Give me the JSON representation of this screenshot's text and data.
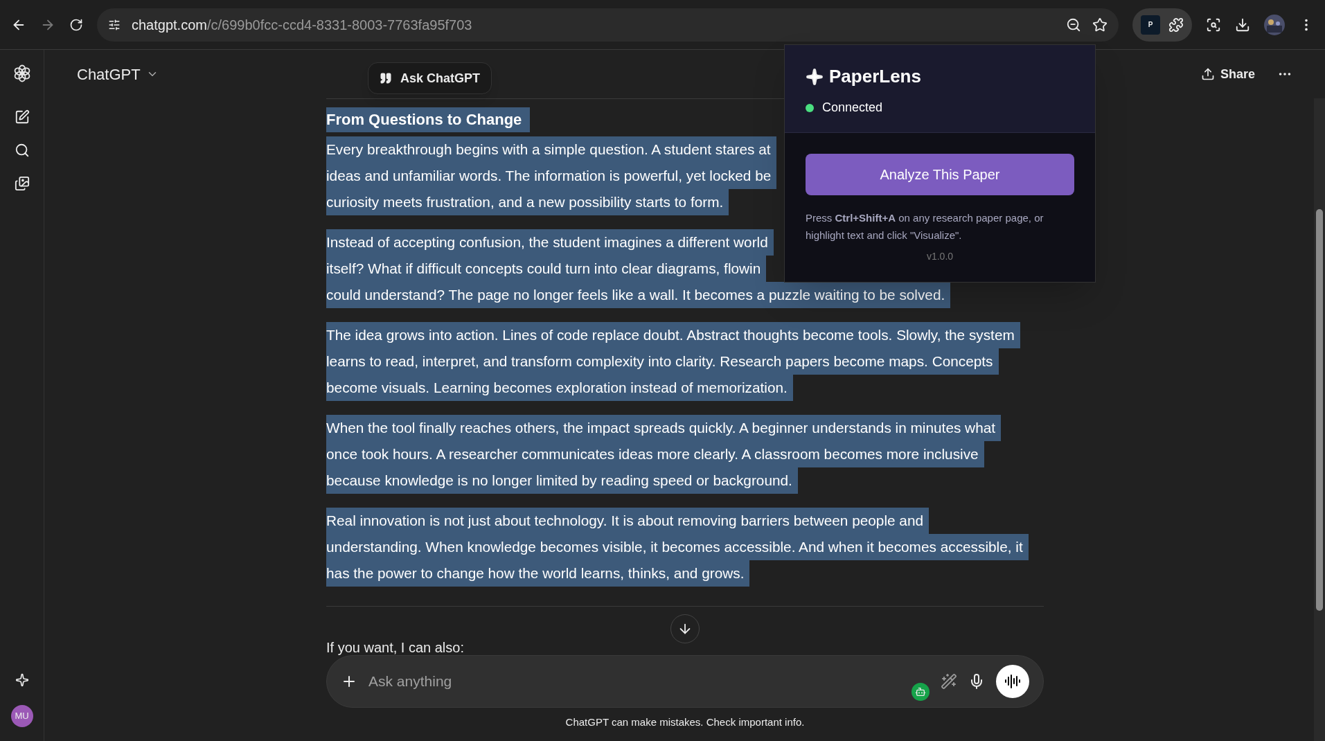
{
  "browser": {
    "url_host": "chatgpt.com",
    "url_path": "/c/699b0fcc-ccd4-8331-8003-7763fa95f703",
    "extension_badge": "P"
  },
  "header": {
    "title": "ChatGPT",
    "share": "Share"
  },
  "sidebar": {
    "avatar": "MU"
  },
  "ask_button": "Ask ChatGPT",
  "article": {
    "heading": "From Questions to Change",
    "paragraphs": [
      [
        "Every breakthrough begins with a simple question. A student stares at",
        "ideas and unfamiliar words. The information is powerful, yet locked be",
        "curiosity meets frustration, and a new possibility starts to form."
      ],
      [
        "Instead of accepting confusion, the student imagines a different world",
        "itself? What if difficult concepts could turn into clear diagrams, flowin",
        "could understand? The page no longer feels like a wall. It becomes a puzzle waiting to be solved."
      ],
      [
        "The idea grows into action. Lines of code replace doubt. Abstract thoughts become tools. Slowly, the system",
        "learns to read, interpret, and transform complexity into clarity. Research papers become maps. Concepts",
        "become visuals. Learning becomes exploration instead of memorization."
      ],
      [
        "When the tool finally reaches others, the impact spreads quickly. A beginner understands in minutes what",
        "once took hours. A researcher communicates ideas more clearly. A classroom becomes more inclusive",
        "because knowledge is no longer limited by reading speed or background."
      ],
      [
        "Real innovation is not just about technology. It is about removing barriers between people and",
        "understanding. When knowledge becomes visible, it becomes accessible. And when it becomes accessible, it",
        "has the power to change how the world learns, thinks, and grows."
      ]
    ]
  },
  "follow_up": "If you want, I can also:",
  "composer": {
    "placeholder": "Ask anything"
  },
  "disclaimer": "ChatGPT can make mistakes. Check important info.",
  "popup": {
    "title": "PaperLens",
    "status": {
      "label": "Connected",
      "connected": true
    },
    "button": "Analyze This Paper",
    "help": "Press **Ctrl+Shift+A** on any research paper page, or highlight text and click \"Visualize\".",
    "version": "v1.0.0"
  }
}
